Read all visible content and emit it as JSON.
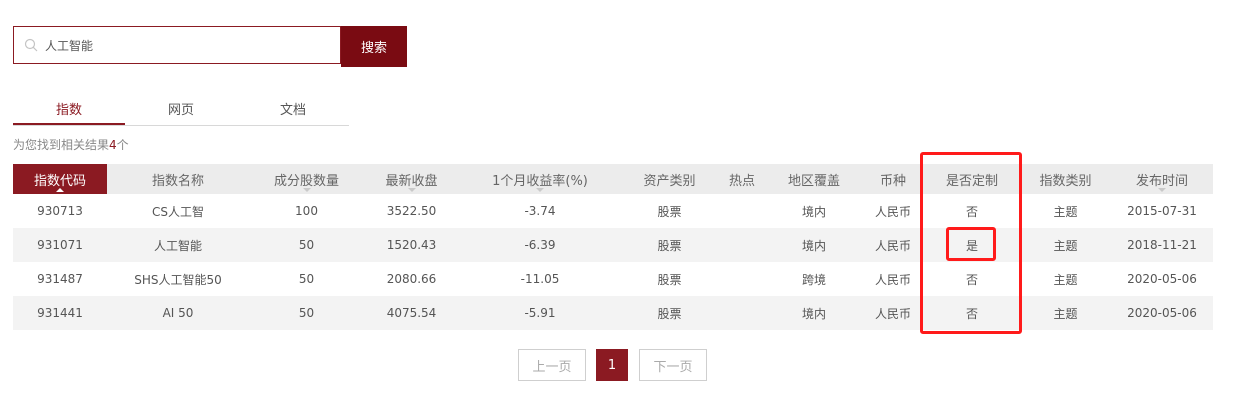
{
  "search": {
    "value": "人工智能",
    "button_label": "搜索"
  },
  "tabs": [
    {
      "label": "指数",
      "active": true
    },
    {
      "label": "网页",
      "active": false
    },
    {
      "label": "文档",
      "active": false
    }
  ],
  "result_summary": {
    "prefix": "为您找到相关结果",
    "count": "4",
    "suffix": "个"
  },
  "table": {
    "headers": [
      "指数代码",
      "指数名称",
      "成分股数量",
      "最新收盘",
      "1个月收益率(%)",
      "资产类别",
      "热点",
      "地区覆盖",
      "币种",
      "是否定制",
      "指数类别",
      "发布时间"
    ],
    "rows": [
      [
        "930713",
        "CS人工智",
        "100",
        "3522.50",
        "-3.74",
        "股票",
        "",
        "境内",
        "人民币",
        "否",
        "主题",
        "2015-07-31"
      ],
      [
        "931071",
        "人工智能",
        "50",
        "1520.43",
        "-6.39",
        "股票",
        "",
        "境内",
        "人民币",
        "是",
        "主题",
        "2018-11-21"
      ],
      [
        "931487",
        "SHS人工智能50",
        "50",
        "2080.66",
        "-11.05",
        "股票",
        "",
        "跨境",
        "人民币",
        "否",
        "主题",
        "2020-05-06"
      ],
      [
        "931441",
        "AI 50",
        "50",
        "4075.54",
        "-5.91",
        "股票",
        "",
        "境内",
        "人民币",
        "否",
        "主题",
        "2020-05-06"
      ]
    ]
  },
  "pagination": {
    "prev_label": "上一页",
    "current_page": "1",
    "next_label": "下一页"
  },
  "colors": {
    "accent": "#8b1a22",
    "highlight_box": "#ff1a1a"
  }
}
